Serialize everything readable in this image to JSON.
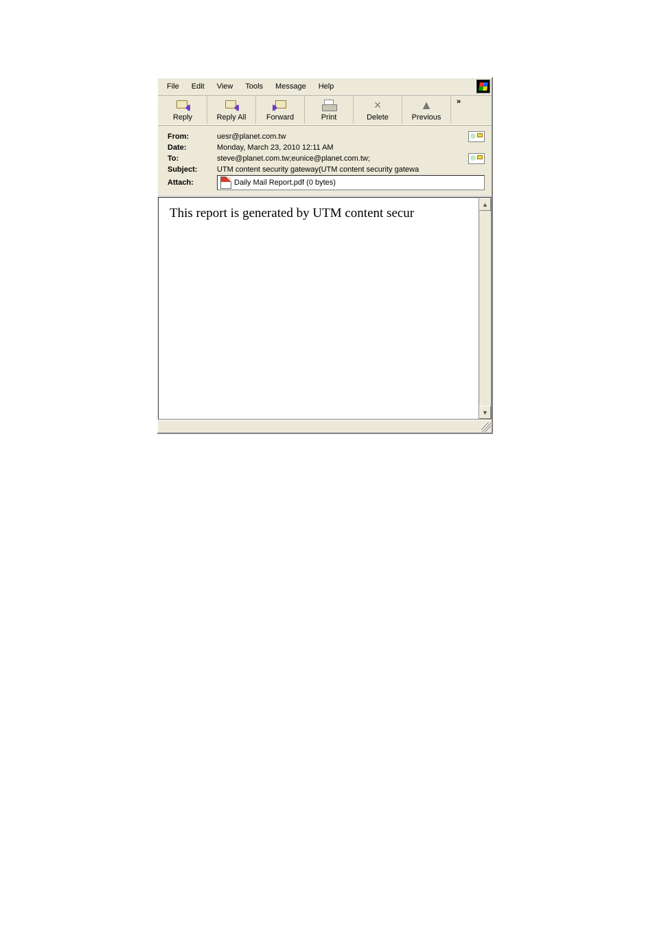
{
  "menu": {
    "file": "File",
    "edit": "Edit",
    "view": "View",
    "tools": "Tools",
    "message": "Message",
    "help": "Help"
  },
  "toolbar": {
    "reply": "Reply",
    "reply_all": "Reply All",
    "forward": "Forward",
    "print": "Print",
    "delete": "Delete",
    "previous": "Previous",
    "overflow": "»"
  },
  "headers": {
    "from_label": "From:",
    "from_value": "uesr@planet.com.tw",
    "date_label": "Date:",
    "date_value": "Monday,  March 23, 2010 12:11 AM",
    "to_label": "To:",
    "to_value": "steve@planet.com.tw;eunice@planet.com.tw;",
    "subject_label": "Subject:",
    "subject_value": "UTM content security gateway(UTM content security gatewa",
    "attach_label": "Attach:",
    "attach_value": "Daily Mail Report.pdf (0 bytes)"
  },
  "body_text": "This report is generated by UTM content secur",
  "scroll": {
    "up": "▲",
    "down": "▼"
  }
}
